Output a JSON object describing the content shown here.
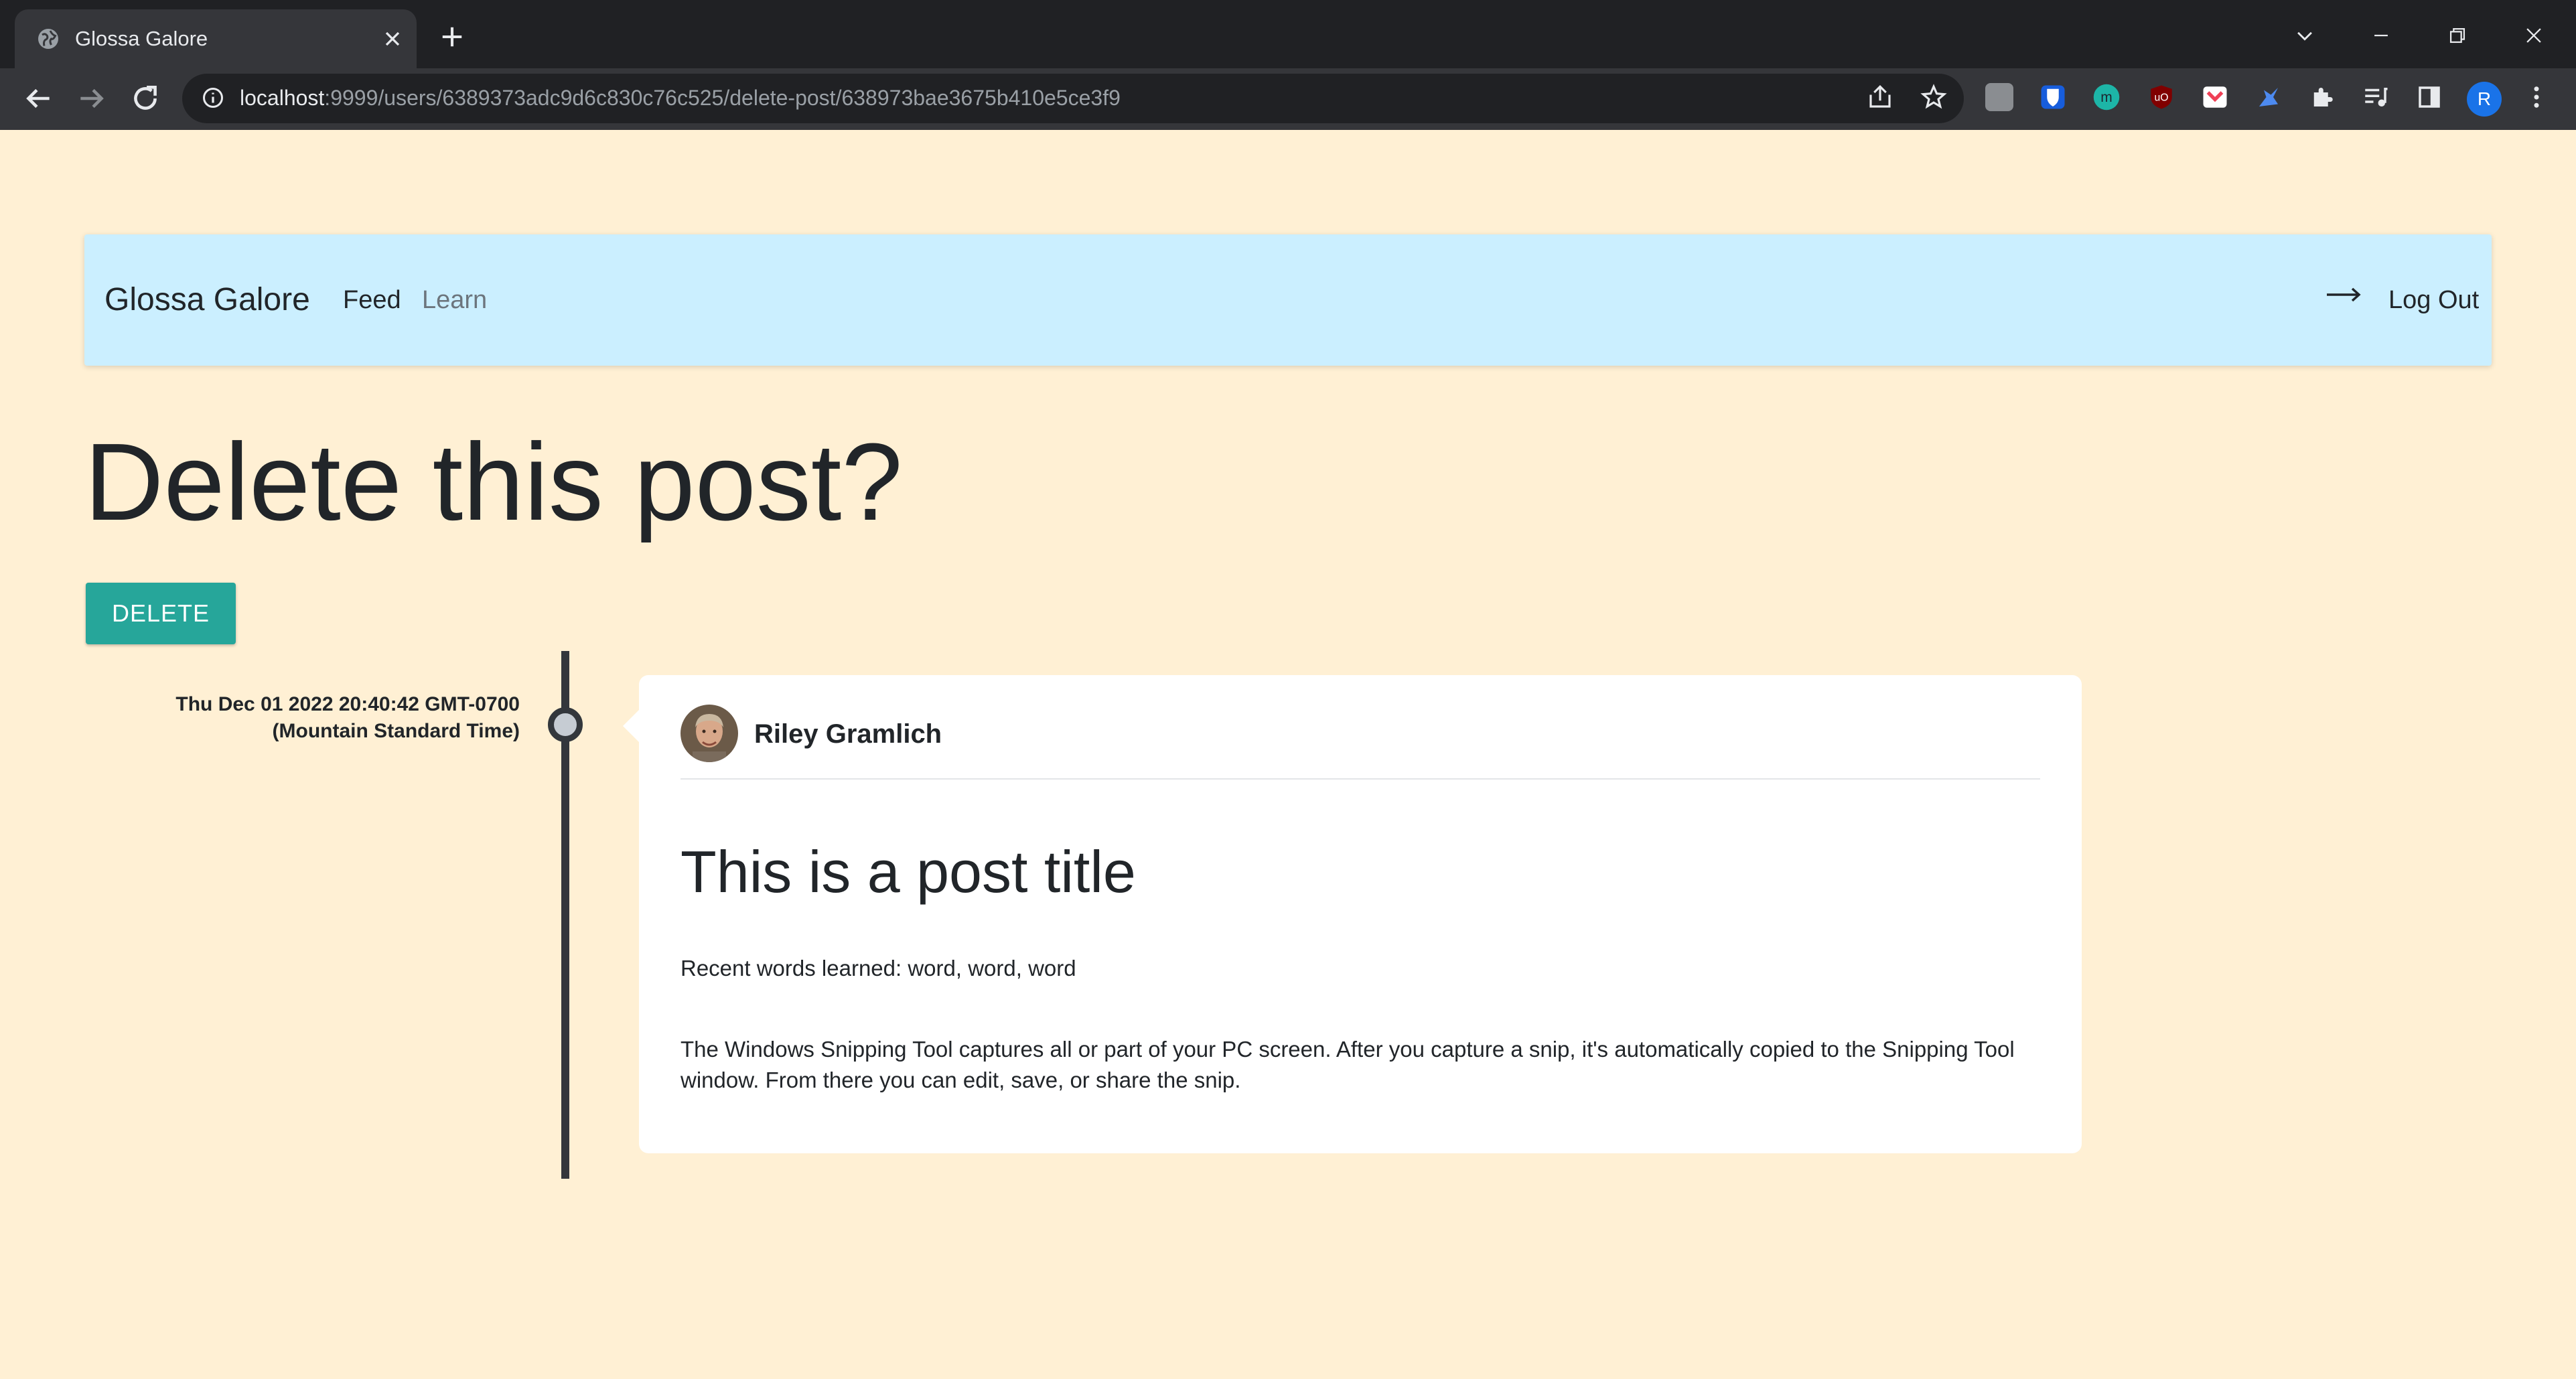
{
  "browser": {
    "tab_title": "Glossa Galore",
    "url_host": "localhost",
    "url_rest": ":9999/users/6389373adc9d6c830c76c525/delete-post/638973bae3675b410e5ce3f9",
    "profile_initial": "R",
    "extensions": [
      "grey-ext-icon",
      "bitwarden-icon",
      "m-ext-icon",
      "ublock-icon",
      "pocket-icon",
      "blue-ext-icon",
      "puzzle-icon",
      "media-icon",
      "sidebar-icon"
    ]
  },
  "navbar": {
    "brand": "Glossa Galore",
    "links": [
      "Feed",
      "Learn"
    ],
    "logout_label": "Log Out"
  },
  "page": {
    "title": "Delete this post?",
    "delete_label": "DELETE"
  },
  "post": {
    "timestamp": "Thu Dec 01 2022 20:40:42 GMT-0700 (Mountain Standard Time)",
    "author": "Riley Gramlich",
    "title": "This is a post title",
    "recent_words": "Recent words learned: word, word, word",
    "body": "The Windows Snipping Tool captures all or part of your PC screen. After you capture a snip, it's automatically copied to the Snipping Tool window. From there you can edit, save, or share the snip."
  },
  "colors": {
    "page_bg": "#fff0d4",
    "navbar_bg": "#cbefff",
    "delete_button": "#26a69a",
    "timeline": "#33373c"
  }
}
